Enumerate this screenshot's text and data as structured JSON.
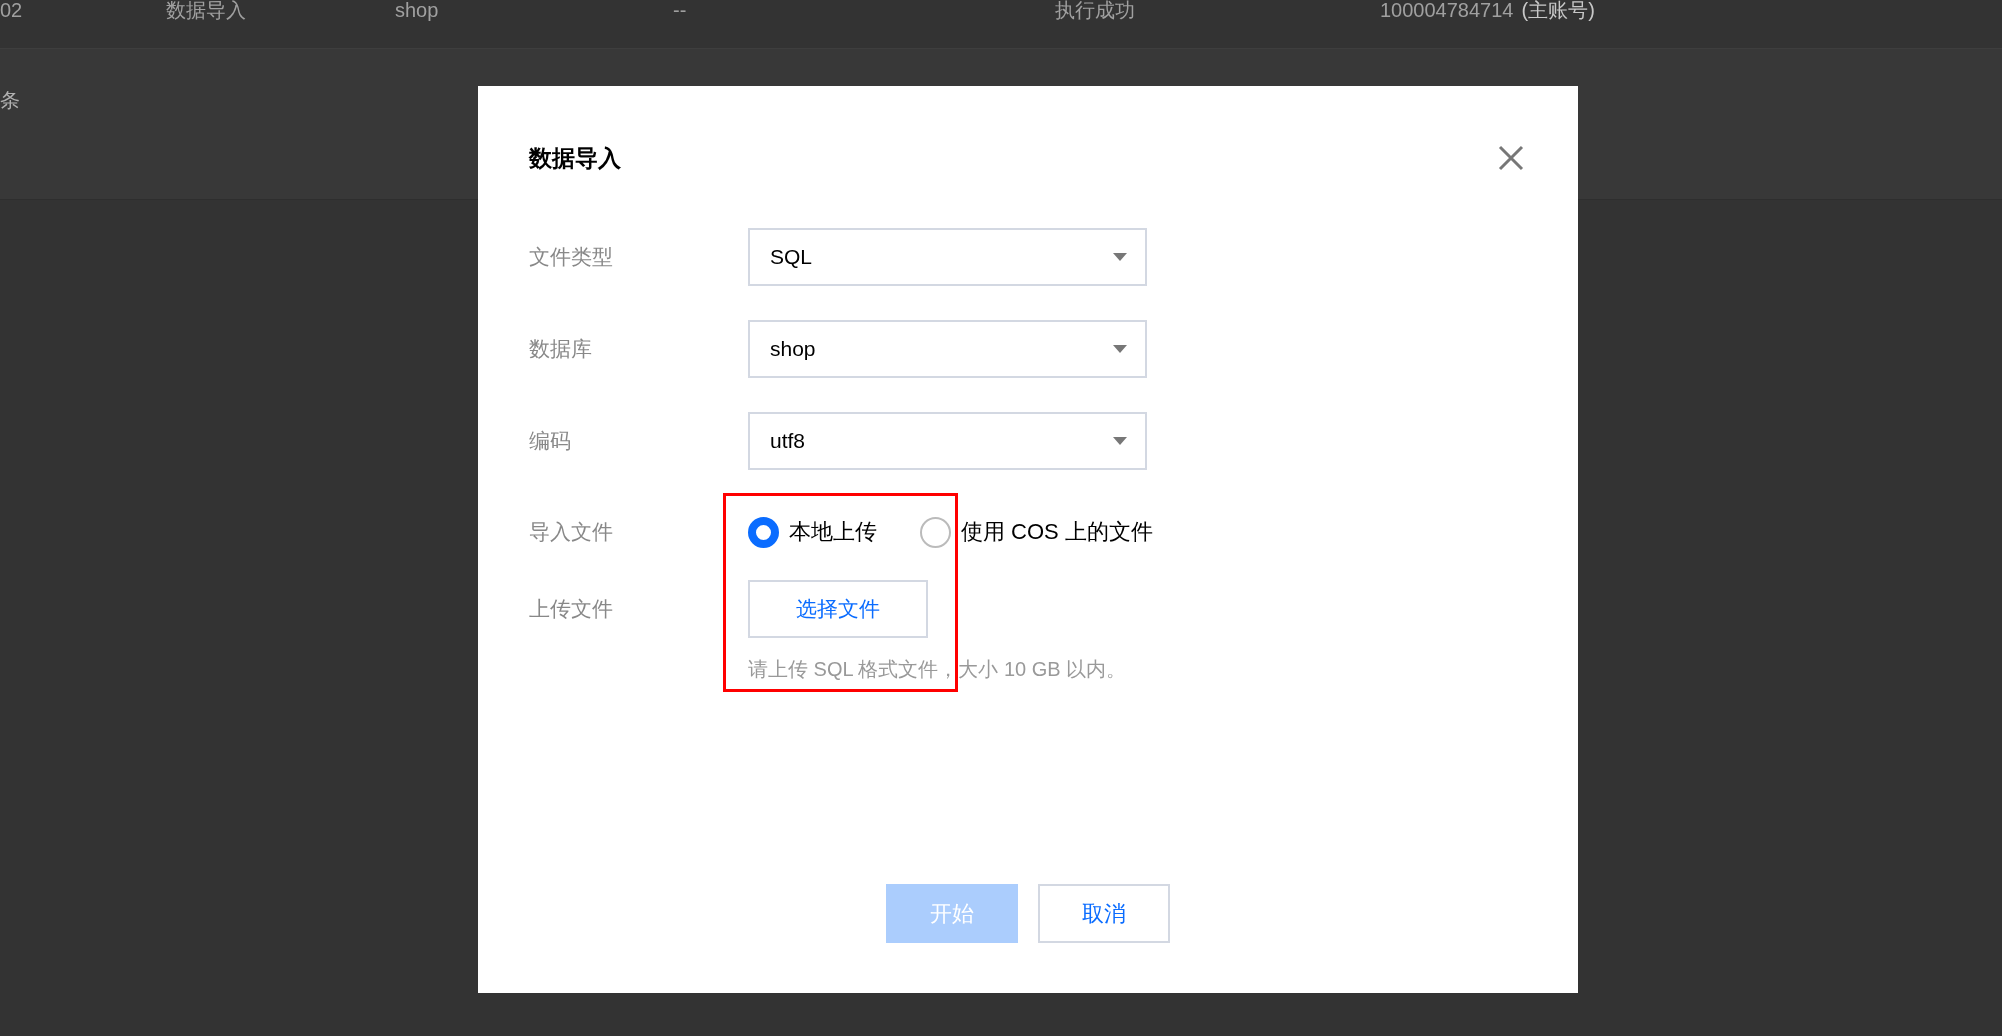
{
  "background_row": {
    "cells": [
      "02",
      "数据导入",
      "shop",
      "--",
      "执行成功",
      "100004784714"
    ],
    "account_note": "(主账号)"
  },
  "background_footer": {
    "text": "条"
  },
  "dialog": {
    "title": "数据导入",
    "fields": [
      {
        "kind": "select",
        "label": "文件类型",
        "value": "SQL"
      },
      {
        "kind": "select",
        "label": "数据库",
        "value": "shop"
      },
      {
        "kind": "select",
        "label": "编码",
        "value": "utf8"
      },
      {
        "kind": "radio",
        "label": "导入文件",
        "options": [
          {
            "label": "本地上传",
            "selected": true
          },
          {
            "label": "使用 COS 上的文件",
            "selected": false
          }
        ]
      },
      {
        "kind": "upload",
        "label": "上传文件",
        "button": "选择文件",
        "hint": "请上传 SQL 格式文件，大小 10 GB 以内。"
      }
    ],
    "buttons": [
      {
        "kind": "primary",
        "label": "开始",
        "disabled": true
      },
      {
        "kind": "secondary",
        "label": "取消",
        "disabled": false
      }
    ]
  }
}
